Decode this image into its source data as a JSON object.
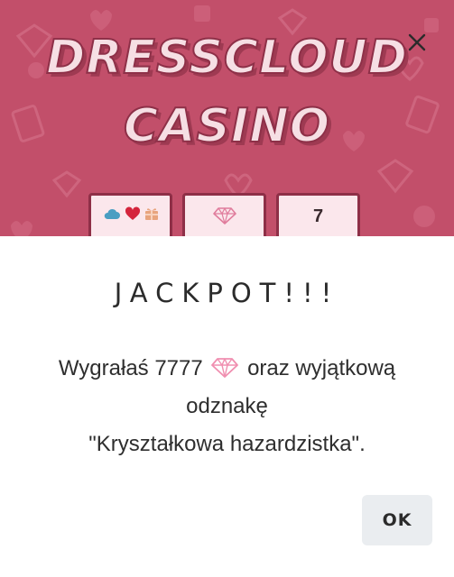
{
  "banner": {
    "title_line1": "DRESSCLOUD",
    "title_line2": "CASINO",
    "background_color": "#c24f6a",
    "slots": [
      {
        "icons": [
          "cloud-icon",
          "heart-icon",
          "gift-icon"
        ]
      },
      {
        "icons": [
          "diamond-icon"
        ]
      },
      {
        "value": "7"
      }
    ]
  },
  "dialog": {
    "title": "JACKPOT!!!",
    "message_before_gem": "Wygrałaś 7777",
    "message_after_gem": "oraz wyjątkową odznakę",
    "message_badge_name": "\"Kryształkowa hazardzistka\".",
    "gem_icon": "diamond-icon",
    "ok_label": "OK",
    "close_icon": "close-icon"
  }
}
